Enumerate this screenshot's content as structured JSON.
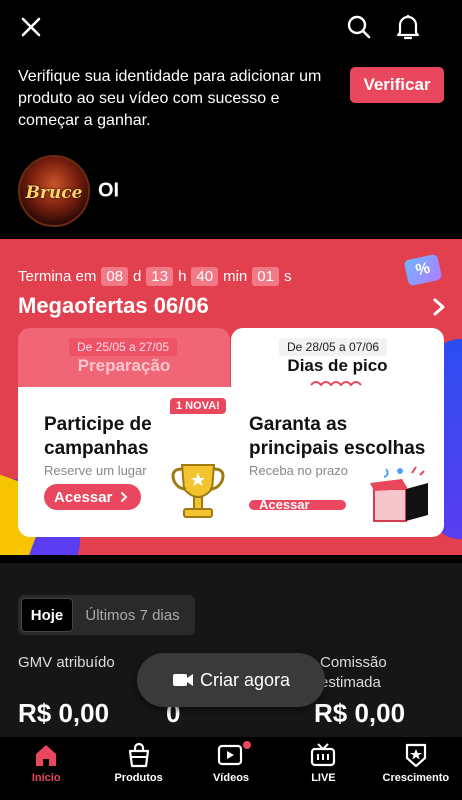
{
  "topbar": {
    "close_icon": "close-icon",
    "search_icon": "search-icon",
    "bell_icon": "bell-icon"
  },
  "verify": {
    "message": "Verifique sua identidade para adicionar um produto ao seu vídeo com sucesso e começar a ganhar.",
    "button": "Verificar"
  },
  "profile": {
    "avatar_text": "Bruce",
    "name_visible": "OI"
  },
  "promo": {
    "ends_label": "Termina em",
    "days": "08",
    "days_unit": "d",
    "hours": "13",
    "hours_unit": "h",
    "minutes": "40",
    "minutes_unit": "min",
    "seconds": "01",
    "seconds_unit": "s",
    "percent_tag": "%",
    "title": "Megaofertas 06/06",
    "tabs": [
      {
        "date": "De 25/05 a 27/05",
        "label": "Preparação"
      },
      {
        "date": "De 28/05 a 07/06",
        "label": "Dias de pico"
      }
    ],
    "cards": [
      {
        "badge": "1 NOVA!",
        "title": "Participe de campanhas",
        "subtitle": "Reserve um lugar",
        "button": "Acessar"
      },
      {
        "title": "Garanta as principais escolhas",
        "subtitle": "Receba no prazo",
        "button": "Acessar"
      }
    ]
  },
  "stats": {
    "period_today": "Hoje",
    "period_7": "Últimos 7 dias",
    "gmv_label": "GMV atribuído",
    "gmv_value": "R$ 0,00",
    "middle_value": "0",
    "commission_label_1": "Comissão",
    "commission_label_2": "estimada",
    "commission_value": "R$ 0,00"
  },
  "create_button": "Criar agora",
  "nav": [
    {
      "label": "Início",
      "icon": "home-icon",
      "active": true
    },
    {
      "label": "Produtos",
      "icon": "shopping-bag-icon"
    },
    {
      "label": "Vídeos",
      "icon": "video-icon"
    },
    {
      "label": "LIVE",
      "icon": "live-tv-icon"
    },
    {
      "label": "Crescimento",
      "icon": "star-badge-icon"
    }
  ],
  "colors": {
    "accent": "#e9475e",
    "promo_bg": "#e2404f"
  }
}
